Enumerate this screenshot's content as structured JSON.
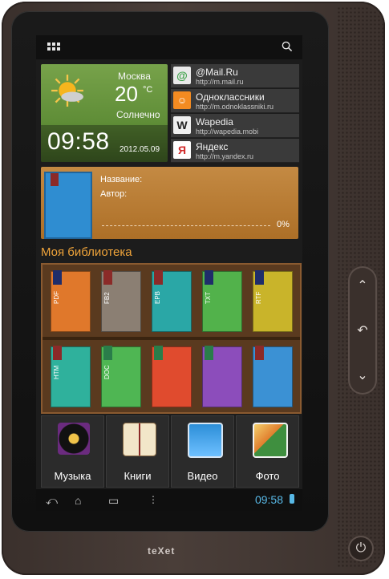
{
  "brand": "teXet",
  "weather": {
    "city": "Москва",
    "temperature": "20",
    "unit": "°C",
    "condition": "Солнечно",
    "time": "09:58",
    "date": "2012.05.09"
  },
  "links": [
    {
      "title": "@Mail.Ru",
      "url": "http://m.mail.ru",
      "icon": "@",
      "color": "#39a0e0"
    },
    {
      "title": "Одноклассники",
      "url": "http://m.odnoklassniki.ru",
      "icon": "ok",
      "color": "#f38b21"
    },
    {
      "title": "Wapedia",
      "url": "http://wapedia.mobi",
      "icon": "W",
      "color": "#e9e9e9"
    },
    {
      "title": "Яндекс",
      "url": "http://m.yandex.ru",
      "icon": "Я",
      "color": "#ffffff"
    }
  ],
  "current_book": {
    "name_label": "Название:",
    "author_label": "Автор:",
    "progress": "0%"
  },
  "library": {
    "title": "Моя библиотека",
    "books": [
      {
        "fmt": "PDF",
        "color": "#e0782b"
      },
      {
        "fmt": "FB2",
        "color": "#8b7f73"
      },
      {
        "fmt": "EPB",
        "color": "#2aa7a6"
      },
      {
        "fmt": "TXT",
        "color": "#52b24b"
      },
      {
        "fmt": "RTF",
        "color": "#c9b42a"
      },
      {
        "fmt": "HTM",
        "color": "#2fb19c"
      },
      {
        "fmt": "DOC",
        "color": "#4fb653"
      },
      {
        "fmt": "",
        "color": "#e04b2e"
      },
      {
        "fmt": "",
        "color": "#8c4dbb"
      },
      {
        "fmt": "",
        "color": "#3b91d4"
      }
    ]
  },
  "dock": [
    {
      "label": "Музыка",
      "icon": "music-icon"
    },
    {
      "label": "Книги",
      "icon": "books-icon"
    },
    {
      "label": "Видео",
      "icon": "video-icon"
    },
    {
      "label": "Фото",
      "icon": "photo-icon"
    }
  ],
  "navbar": {
    "time": "09:58"
  },
  "side": {
    "up": "⌃",
    "back": "↶",
    "down": "⌄",
    "power": "⏻"
  }
}
